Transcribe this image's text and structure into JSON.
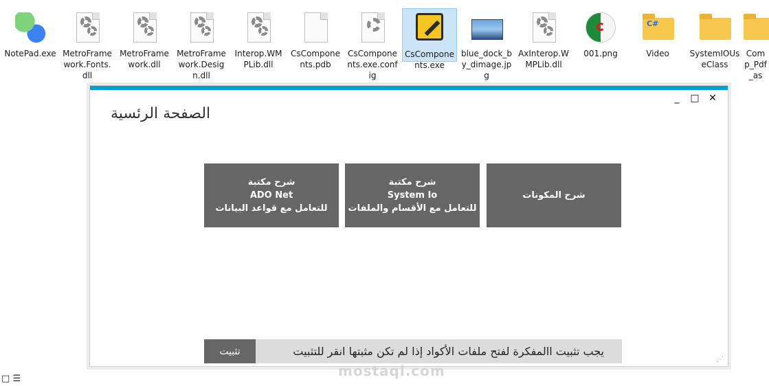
{
  "desktop": {
    "icons": [
      {
        "label": "NotePad.exe",
        "icon": "notepad-exe-icon"
      },
      {
        "label": "MetroFramework.Fonts.dll",
        "icon": "dll-gear-icon"
      },
      {
        "label": "MetroFramework.dll",
        "icon": "dll-gear-icon"
      },
      {
        "label": "MetroFramework.Design.dll",
        "icon": "dll-gear-icon"
      },
      {
        "label": "Interop.WMPLib.dll",
        "icon": "dll-gear-icon"
      },
      {
        "label": "CsComponents.pdb",
        "icon": "blank-file-icon"
      },
      {
        "label": "CsComponents.exe.config",
        "icon": "config-gear-icon"
      },
      {
        "label": "CsComponents.exe",
        "icon": "pencil-exe-icon",
        "selected": true
      },
      {
        "label": "blue_dock_by_dimage.jpg",
        "icon": "image-thumbnail-icon"
      },
      {
        "label": "AxInterop.WMPLib.dll",
        "icon": "dll-gear-icon"
      },
      {
        "label": "001.png",
        "icon": "algeria-flag-icon"
      },
      {
        "label": "Video",
        "icon": "folder-icon"
      },
      {
        "label": "SystemIOUseClass",
        "icon": "folder-icon"
      },
      {
        "label": "Comp_Pdf_as",
        "icon": "folder-icon"
      }
    ],
    "folder_badge": "C#"
  },
  "window": {
    "title": "الصفحة الرئسية",
    "controls": {
      "minimize": "_",
      "maximize": "□",
      "close": "✕"
    },
    "tiles": [
      {
        "lines": [
          "شرح المكونات"
        ]
      },
      {
        "lines": [
          "شرح  مكتبة",
          "System Io",
          "للتعامل مع الأقسام والملفات"
        ]
      },
      {
        "lines": [
          "شرح مكتبة",
          "ADO Net",
          "للتعامل مع قواعد البيانات"
        ]
      }
    ],
    "install": {
      "button": "تثبيت",
      "message": "يجب تثبيت االمفكرة لفتح ملفات الأكواد إذا لم تكن مثبتها انقر للتثبيت"
    },
    "colors": {
      "accent": "#00a0d2",
      "tile": "#666666",
      "bar": "#dcdcdc"
    }
  },
  "watermark": "mostaql.com",
  "taskbar": {
    "view_icons": [
      "□",
      "☰"
    ]
  }
}
